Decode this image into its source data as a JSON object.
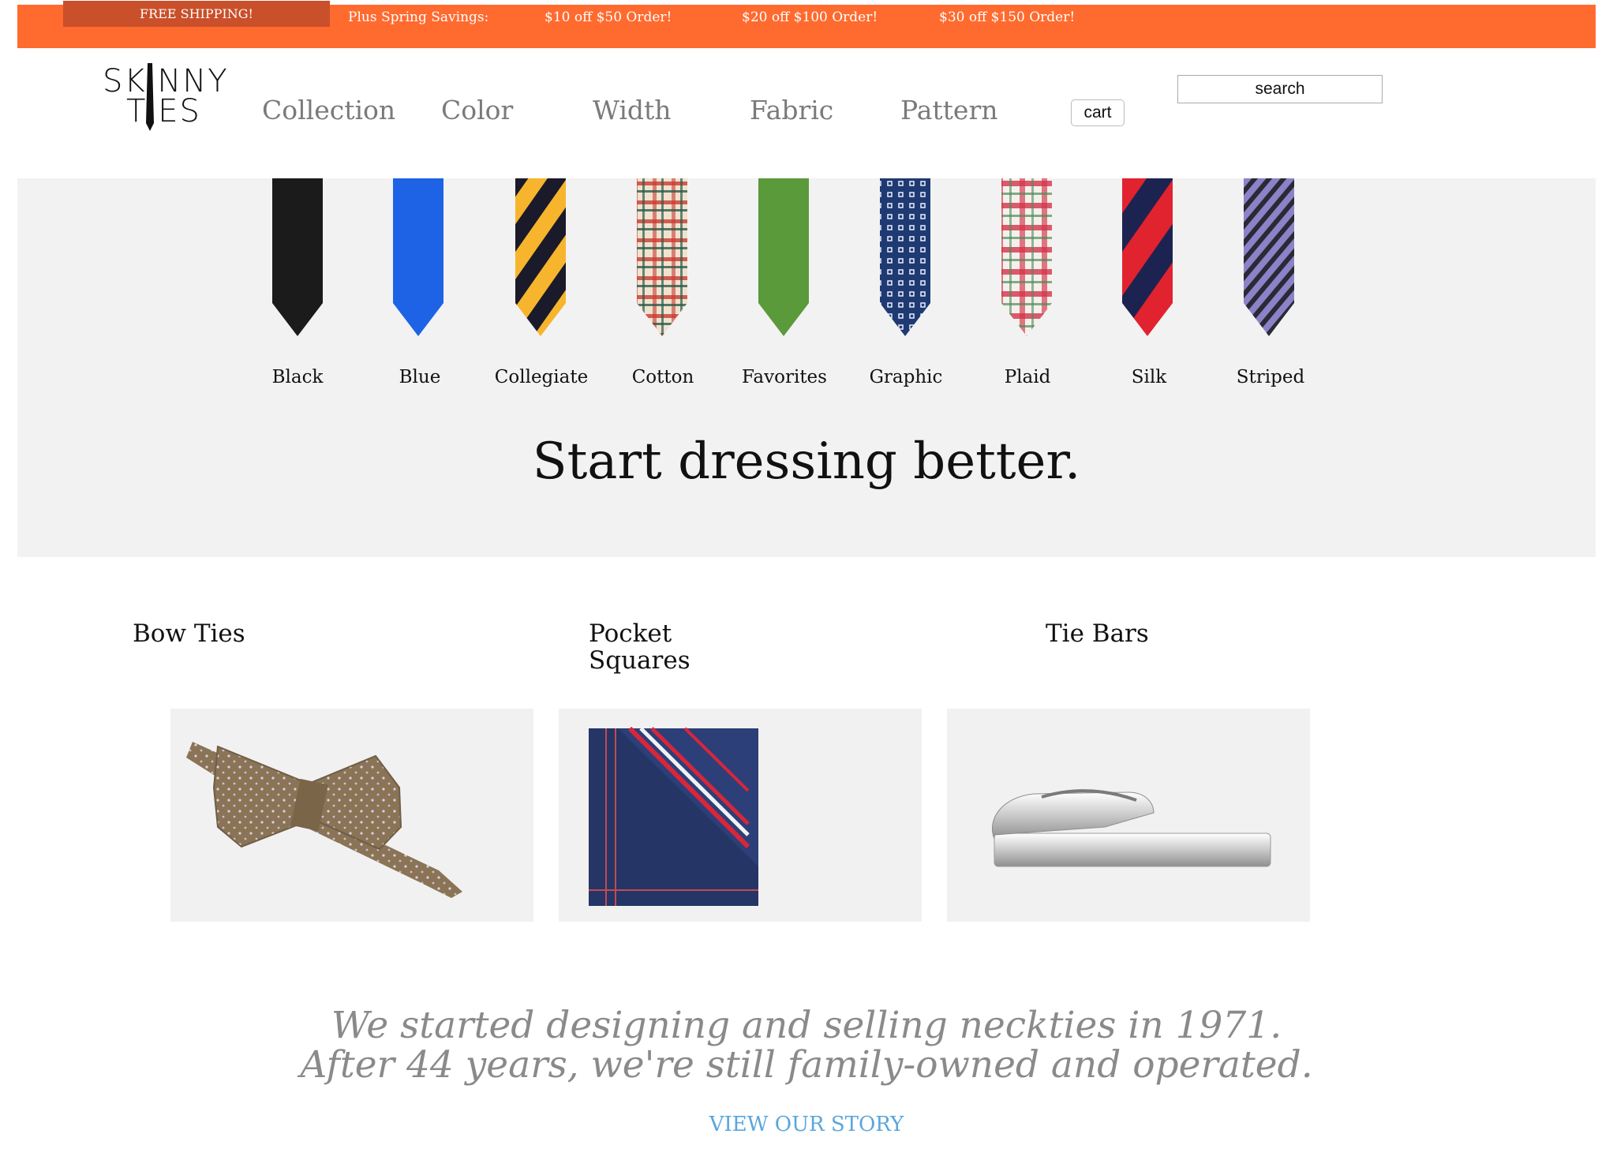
{
  "promo": {
    "free_shipping": "FREE SHIPPING!",
    "spring": "Plus Spring Savings:",
    "offer1": "$10 off $50 Order!",
    "offer2": "$20 off $100 Order!",
    "offer3": "$30 off $150 Order!"
  },
  "header": {
    "logo_line1": "SKINNY",
    "logo_line2": "TIES",
    "nav": [
      "Collection",
      "Color",
      "Width",
      "Fabric",
      "Pattern"
    ],
    "cart": "cart",
    "search_placeholder": "search"
  },
  "hero": {
    "ties": [
      "Black",
      "Blue",
      "Collegiate",
      "Cotton",
      "Favorites",
      "Graphic",
      "Plaid",
      "Silk",
      "Striped"
    ],
    "title": "Start dressing better."
  },
  "categories": [
    {
      "title": "Bow Ties"
    },
    {
      "title": "Pocket Squares"
    },
    {
      "title": "Tie Bars"
    }
  ],
  "story": {
    "line1": "We started designing and selling neckties in 1971.",
    "line2": "After 44 years, we're still family-owned and operated.",
    "link": "VIEW OUR STORY"
  },
  "colors": {
    "promo_bar": "#ff6a2f",
    "free_shipping_bg": "#c9502a",
    "link": "#5aa6dc"
  }
}
